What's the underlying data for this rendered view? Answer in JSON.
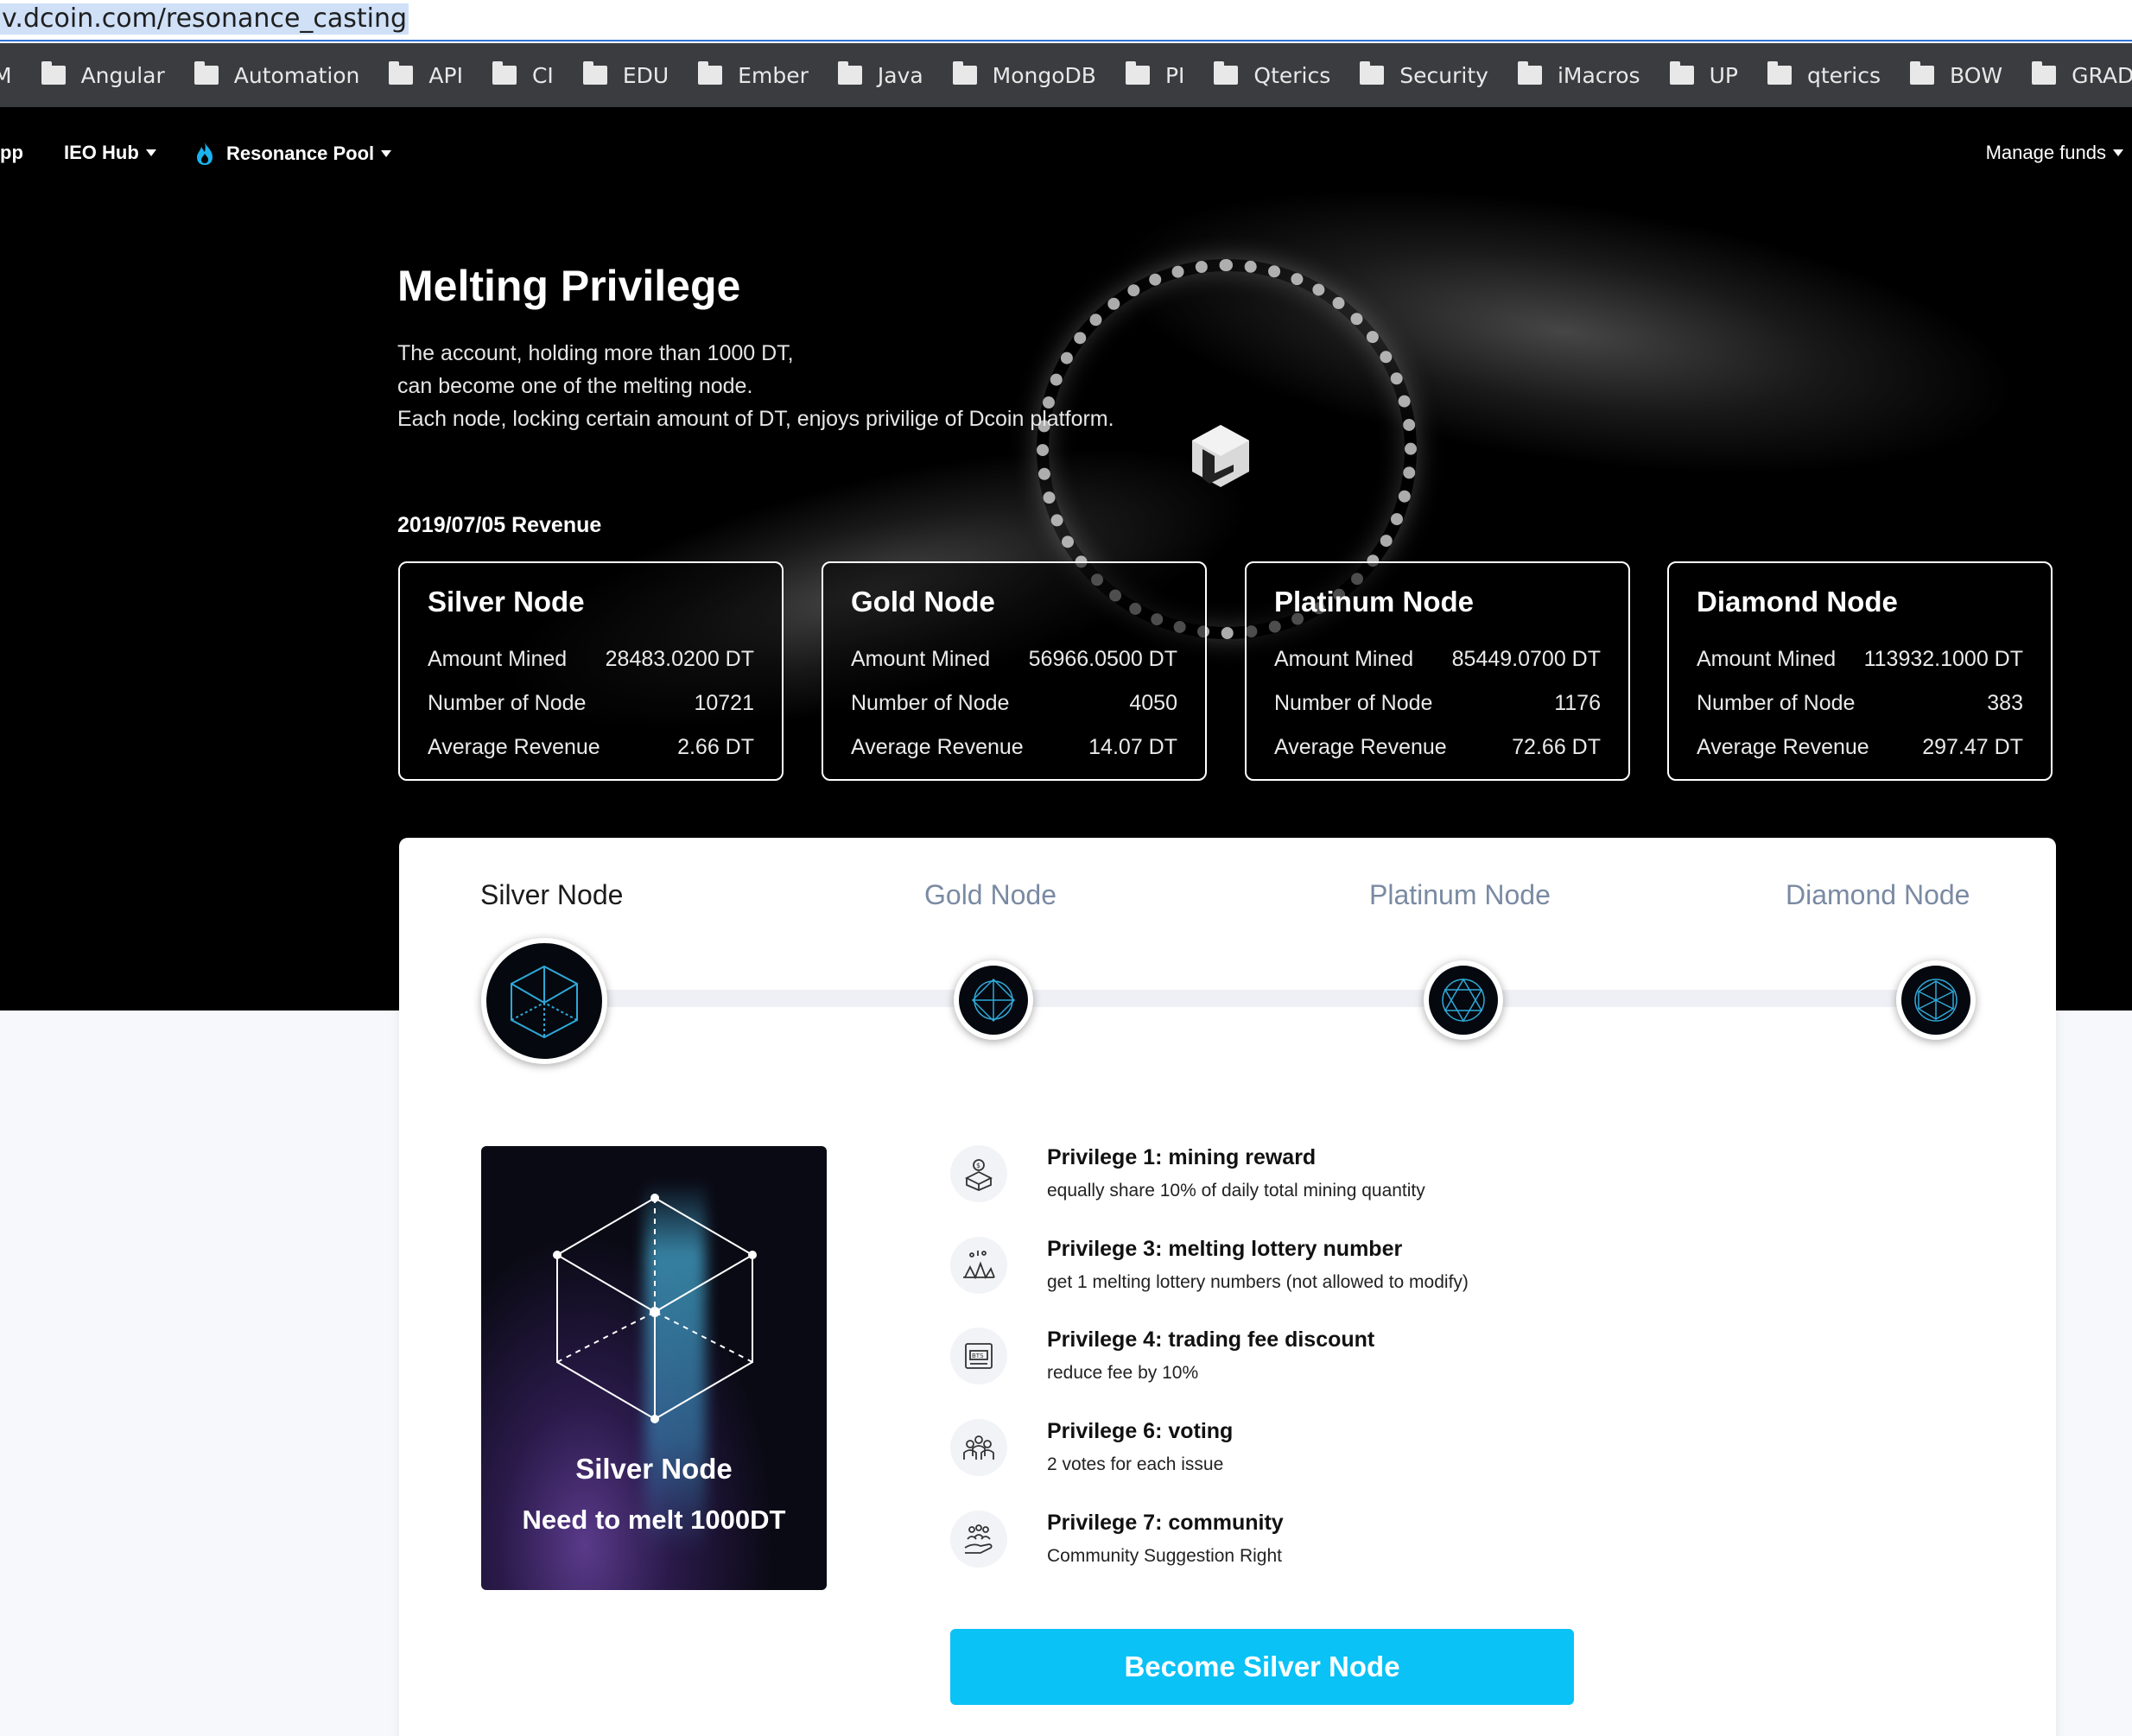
{
  "browser": {
    "url": "v.dcoin.com/resonance_casting",
    "bookmarks": [
      "M",
      "Angular",
      "Automation",
      "API",
      "CI",
      "EDU",
      "Ember",
      "Java",
      "MongoDB",
      "PI",
      "Qterics",
      "Security",
      "iMacros",
      "UP",
      "qterics",
      "BOW",
      "GRAD"
    ]
  },
  "nav": {
    "app_partial": "pp",
    "ieo_hub": "IEO Hub",
    "resonance_pool": "Resonance Pool",
    "manage_funds": "Manage funds"
  },
  "hero": {
    "title": "Melting Privilege",
    "desc_line1": "The account, holding more than 1000 DT,",
    "desc_line2": "can become one of the melting node.",
    "desc_line3": "Each node, locking certain amount of DT, enjoys privilige of Dcoin platform.",
    "revenue_date": "2019/07/05 Revenue"
  },
  "nodes": [
    {
      "name": "Silver Node",
      "amount_label": "Amount Mined",
      "amount": "28483.0200 DT",
      "count_label": "Number of Node",
      "count": "10721",
      "avg_label": "Average Revenue",
      "avg": "2.66 DT"
    },
    {
      "name": "Gold Node",
      "amount_label": "Amount Mined",
      "amount": "56966.0500 DT",
      "count_label": "Number of Node",
      "count": "4050",
      "avg_label": "Average Revenue",
      "avg": "14.07 DT"
    },
    {
      "name": "Platinum Node",
      "amount_label": "Amount Mined",
      "amount": "85449.0700 DT",
      "count_label": "Number of Node",
      "count": "1176",
      "avg_label": "Average Revenue",
      "avg": "72.66 DT"
    },
    {
      "name": "Diamond Node",
      "amount_label": "Amount Mined",
      "amount": "113932.1000 DT",
      "count_label": "Number of Node",
      "count": "383",
      "avg_label": "Average Revenue",
      "avg": "297.47 DT"
    }
  ],
  "tabs": [
    "Silver Node",
    "Gold Node",
    "Platinum Node",
    "Diamond Node"
  ],
  "selected": {
    "image_title": "Silver Node",
    "image_sub": "Need to melt 1000DT",
    "button": "Become Silver Node"
  },
  "privileges": [
    {
      "title": "Privilege 1: mining reward",
      "desc": "equally share 10% of daily total mining quantity",
      "icon": "coin-box-icon"
    },
    {
      "title": "Privilege 3: melting lottery number",
      "desc": "get 1 melting lottery numbers (not allowed to modify)",
      "icon": "lottery-icon"
    },
    {
      "title": "Privilege 4: trading fee discount",
      "desc": "reduce fee by 10%",
      "icon": "bts-ticket-icon"
    },
    {
      "title": "Privilege 6: voting",
      "desc": "2 votes for each issue",
      "icon": "voting-people-icon"
    },
    {
      "title": "Privilege 7: community",
      "desc": "Community Suggestion Right",
      "icon": "community-hand-icon"
    }
  ],
  "colors": {
    "accent": "#0ac2f6",
    "hero_bg": "#000000",
    "tab_inactive": "#7a8aa3"
  }
}
